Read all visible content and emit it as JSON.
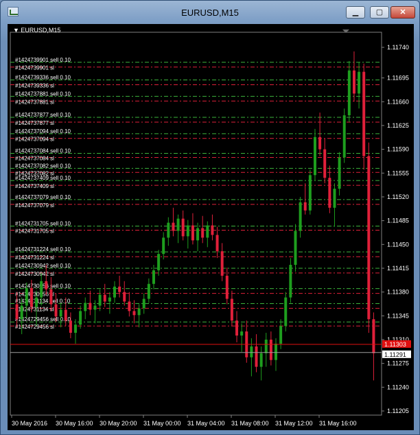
{
  "window": {
    "title": "EURUSD,M15",
    "minimize_glyph": "▁",
    "maximize_glyph": "▢",
    "close_glyph": "✕"
  },
  "colors": {
    "background": "#000000",
    "bull": "#1e9e1e",
    "bear": "#e0203a",
    "sell_line": "#3cb43c",
    "sl_line": "#e0203a",
    "bid_line": "#e01010",
    "ask_line": "#a0a0a0",
    "text": "#ffffff"
  },
  "chart_data": {
    "type": "candlestick",
    "symbol_label": "EURUSD,M15",
    "y_ticks": [
      "1.11740",
      "1.11695",
      "1.11660",
      "1.11625",
      "1.11590",
      "1.11555",
      "1.11520",
      "1.11485",
      "1.11450",
      "1.11415",
      "1.11380",
      "1.11345",
      "1.11310",
      "1.11275",
      "1.11240",
      "1.11205"
    ],
    "ylim": [
      1.11205,
      1.1174
    ],
    "x_ticks": [
      "30 May 2016",
      "30 May 16:00",
      "30 May 20:00",
      "31 May 00:00",
      "31 May 04:00",
      "31 May 08:00",
      "31 May 12:00",
      "31 May 16:00"
    ],
    "bid_price": "1.11303",
    "ask_price": "1.11291",
    "bid_value": 1.11303,
    "ask_value": 1.11291,
    "orders": [
      {
        "sell_label": "#1424739901 sell 0.10",
        "sl_label": "#1424739901 sl",
        "sell_price": 1.11718,
        "sl_price": 1.11711
      },
      {
        "sell_label": "#1424739336 sell 0.10",
        "sl_label": "#1424739336 sl",
        "sell_price": 1.11692,
        "sl_price": 1.11685
      },
      {
        "sell_label": "#1424737881 sell 0.10",
        "sl_label": "#1424737881 sl",
        "sell_price": 1.11668,
        "sl_price": 1.11661
      },
      {
        "sell_label": "#1424737877 sell 0.10",
        "sl_label": "#1424737877 sl",
        "sell_price": 1.11637,
        "sl_price": 1.1163
      },
      {
        "sell_label": "#1424737094 sell 0.10",
        "sl_label": "#1424737094 sl",
        "sell_price": 1.11613,
        "sl_price": 1.11606
      },
      {
        "sell_label": "#1424737084 sell 0.10",
        "sl_label": "#1424737084 sl",
        "sell_price": 1.11584,
        "sl_price": 1.11578
      },
      {
        "sell_label": "#1424737082 sell 0.10",
        "sl_label": "#1424737082 sl",
        "sell_price": 1.11562,
        "sl_price": 1.11556
      },
      {
        "sell_label": "#1424737409 sell 0.10",
        "sl_label": "#1424737409 sl",
        "sell_price": 1.11544,
        "sl_price": 1.11537
      },
      {
        "sell_label": "#1424737079 sell 0.10",
        "sl_label": "#1424737079 sl",
        "sell_price": 1.11516,
        "sl_price": 1.11509
      },
      {
        "sell_label": "#1424731705 sell 0.10",
        "sl_label": "#1424731705 sl",
        "sell_price": 1.11477,
        "sl_price": 1.11471
      },
      {
        "sell_label": "#1424731224 sell 0.10",
        "sl_label": "#1424731224 sl",
        "sell_price": 1.11439,
        "sl_price": 1.11432
      },
      {
        "sell_label": "#1424730942 sell 0.10",
        "sl_label": "#1424730942 sl",
        "sell_price": 1.11415,
        "sl_price": 1.11408
      },
      {
        "sell_label": "#1424730956 sell 0.10",
        "sl_label": "#1424730956 sl",
        "sell_price": 1.11385,
        "sl_price": 1.11378
      },
      {
        "sell_label": "#1424731134 sell 0.10",
        "sl_label": "#1424731134 sl",
        "sell_price": 1.11363,
        "sl_price": 1.11356
      },
      {
        "sell_label": "#1424729456 sell 0.10",
        "sl_label": "#1424729456 sl",
        "sell_price": 1.11336,
        "sl_price": 1.1133
      }
    ],
    "candles": [
      [
        1.11362,
        1.1138,
        1.11328,
        1.1134
      ],
      [
        1.1134,
        1.11372,
        1.11318,
        1.1136
      ],
      [
        1.1136,
        1.11394,
        1.11342,
        1.11386
      ],
      [
        1.11386,
        1.11398,
        1.1135,
        1.11358
      ],
      [
        1.11358,
        1.11382,
        1.1133,
        1.11372
      ],
      [
        1.11372,
        1.11408,
        1.1136,
        1.11396
      ],
      [
        1.11396,
        1.1142,
        1.11376,
        1.11384
      ],
      [
        1.11384,
        1.11402,
        1.11352,
        1.11362
      ],
      [
        1.11362,
        1.11378,
        1.11336,
        1.11344
      ],
      [
        1.11344,
        1.11362,
        1.11328,
        1.11354
      ],
      [
        1.11354,
        1.11372,
        1.1133,
        1.11338
      ],
      [
        1.11338,
        1.1135,
        1.11312,
        1.1132
      ],
      [
        1.1132,
        1.1134,
        1.11304,
        1.11332
      ],
      [
        1.11332,
        1.1136,
        1.11326,
        1.11352
      ],
      [
        1.11352,
        1.11372,
        1.1134,
        1.11364
      ],
      [
        1.11364,
        1.11382,
        1.11346,
        1.11354
      ],
      [
        1.11354,
        1.11368,
        1.11334,
        1.1136
      ],
      [
        1.1136,
        1.11384,
        1.11352,
        1.11376
      ],
      [
        1.11376,
        1.11392,
        1.11358,
        1.11366
      ],
      [
        1.11366,
        1.1138,
        1.11348,
        1.11372
      ],
      [
        1.11372,
        1.11396,
        1.11364,
        1.11388
      ],
      [
        1.11388,
        1.11404,
        1.11372,
        1.1138
      ],
      [
        1.1138,
        1.11396,
        1.1136,
        1.11366
      ],
      [
        1.11366,
        1.1138,
        1.11344,
        1.11352
      ],
      [
        1.11352,
        1.11368,
        1.11334,
        1.11346
      ],
      [
        1.11346,
        1.11362,
        1.11328,
        1.11356
      ],
      [
        1.11356,
        1.11378,
        1.11348,
        1.1137
      ],
      [
        1.1137,
        1.114,
        1.11364,
        1.11392
      ],
      [
        1.11392,
        1.1142,
        1.11384,
        1.11412
      ],
      [
        1.11412,
        1.11442,
        1.11404,
        1.11436
      ],
      [
        1.11436,
        1.11468,
        1.11428,
        1.1146
      ],
      [
        1.1146,
        1.1149,
        1.11448,
        1.11482
      ],
      [
        1.11482,
        1.11504,
        1.11462,
        1.1147
      ],
      [
        1.1147,
        1.11494,
        1.11452,
        1.11488
      ],
      [
        1.11488,
        1.115,
        1.11456,
        1.11462
      ],
      [
        1.11462,
        1.11486,
        1.11444,
        1.11478
      ],
      [
        1.11478,
        1.11496,
        1.1145,
        1.11456
      ],
      [
        1.11456,
        1.11482,
        1.1144,
        1.11474
      ],
      [
        1.11474,
        1.11492,
        1.11452,
        1.1146
      ],
      [
        1.1146,
        1.11484,
        1.11446,
        1.11478
      ],
      [
        1.11478,
        1.11494,
        1.11456,
        1.11464
      ],
      [
        1.11464,
        1.11476,
        1.1143,
        1.1144
      ],
      [
        1.1144,
        1.11452,
        1.11396,
        1.11404
      ],
      [
        1.11404,
        1.11416,
        1.11362,
        1.1137
      ],
      [
        1.1137,
        1.11382,
        1.1133,
        1.11338
      ],
      [
        1.11338,
        1.11352,
        1.11306,
        1.11316
      ],
      [
        1.11316,
        1.11334,
        1.11292,
        1.11322
      ],
      [
        1.11322,
        1.11338,
        1.11276,
        1.11284
      ],
      [
        1.11284,
        1.11312,
        1.11256,
        1.113
      ],
      [
        1.113,
        1.11318,
        1.11262,
        1.1127
      ],
      [
        1.1127,
        1.113,
        1.1125,
        1.1129
      ],
      [
        1.1129,
        1.1132,
        1.1127,
        1.1131
      ],
      [
        1.1131,
        1.11322,
        1.11272,
        1.1128
      ],
      [
        1.1128,
        1.11312,
        1.11264,
        1.11304
      ],
      [
        1.11304,
        1.1134,
        1.11296,
        1.1133
      ],
      [
        1.1133,
        1.1138,
        1.11322,
        1.11372
      ],
      [
        1.11372,
        1.1143,
        1.11364,
        1.1142
      ],
      [
        1.1142,
        1.1148,
        1.1141,
        1.1147
      ],
      [
        1.1147,
        1.1152,
        1.1146,
        1.11512
      ],
      [
        1.11512,
        1.1154,
        1.11494,
        1.115
      ],
      [
        1.115,
        1.1156,
        1.11494,
        1.11552
      ],
      [
        1.11552,
        1.1162,
        1.11544,
        1.11608
      ],
      [
        1.11608,
        1.11644,
        1.1158,
        1.1159
      ],
      [
        1.1159,
        1.11606,
        1.1154,
        1.11548
      ],
      [
        1.11548,
        1.11566,
        1.11496,
        1.11504
      ],
      [
        1.11504,
        1.1154,
        1.11476,
        1.11532
      ],
      [
        1.11532,
        1.11586,
        1.11522,
        1.11578
      ],
      [
        1.11578,
        1.1165,
        1.1157,
        1.1164
      ],
      [
        1.1164,
        1.1172,
        1.1163,
        1.11706
      ],
      [
        1.11706,
        1.11734,
        1.1166,
        1.11672
      ],
      [
        1.11672,
        1.11718,
        1.1165,
        1.11704
      ],
      [
        1.11704,
        1.11716,
        1.1156,
        1.1158
      ],
      [
        1.1158,
        1.116,
        1.1132,
        1.1134
      ],
      [
        1.1134,
        1.1135,
        1.1125,
        1.1129
      ]
    ]
  }
}
